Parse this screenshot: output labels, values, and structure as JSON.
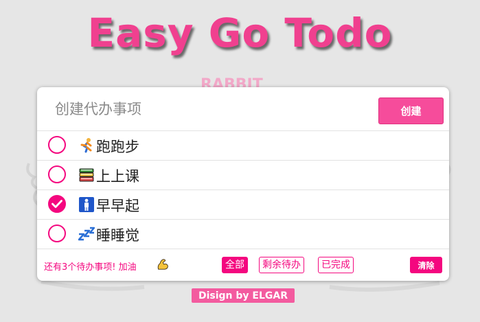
{
  "app": {
    "title": "Easy Go Todo"
  },
  "input": {
    "placeholder": "创建代办事项",
    "value": ""
  },
  "create_button": {
    "label": "创建"
  },
  "todos": [
    {
      "icon": "running-person-icon",
      "text": "跑跑步",
      "done": false
    },
    {
      "icon": "books-icon",
      "text": "上上课",
      "done": false
    },
    {
      "icon": "standing-person-icon",
      "text": "早早起",
      "done": true
    },
    {
      "icon": "sleeping-zzz-icon",
      "text": "睡睡觉",
      "done": false
    }
  ],
  "footer": {
    "remaining_text": "还有3个待办事项! 加油",
    "filters": [
      {
        "label": "全部",
        "active": true
      },
      {
        "label": "剩余待办",
        "active": false
      },
      {
        "label": "已完成",
        "active": false
      }
    ],
    "clear_label": "清除"
  },
  "credit": "Disign by ELGAR",
  "colors": {
    "accent": "#f4077f",
    "title": "#f0408f",
    "button": "#f64c9b"
  }
}
